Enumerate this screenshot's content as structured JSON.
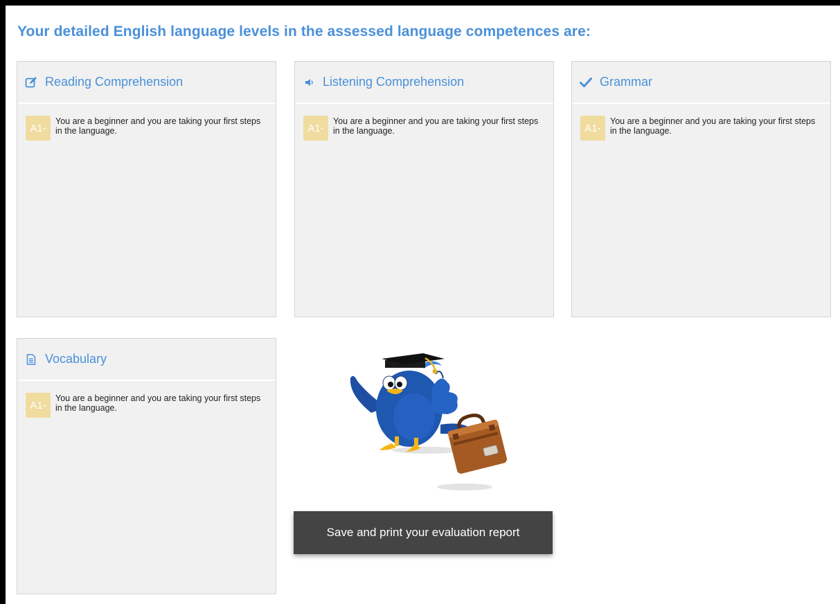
{
  "page": {
    "heading": "Your detailed English language levels in the assessed language competences are:",
    "accent_color": "#4a90d9",
    "badge_color": "#f0dc9f"
  },
  "cards": [
    {
      "title": "Reading Comprehension",
      "icon": "edit-icon",
      "level": "A1-",
      "description": "You are a beginner and you are taking your first steps in the language."
    },
    {
      "title": "Listening Comprehension",
      "icon": "speaker-icon",
      "level": "A1-",
      "description": "You are a beginner and you are taking your first steps in the language."
    },
    {
      "title": "Grammar",
      "icon": "check-icon",
      "level": "A1-",
      "description": "You are a beginner and you are taking your first steps in the language."
    },
    {
      "title": "Vocabulary",
      "icon": "document-icon",
      "level": "A1-",
      "description": "You are a beginner and you are taking your first steps in the language."
    }
  ],
  "mascot": {
    "icon": "graduate-bird-with-suitcase-illustration"
  },
  "actions": {
    "save_label": "Save and print your evaluation report"
  }
}
